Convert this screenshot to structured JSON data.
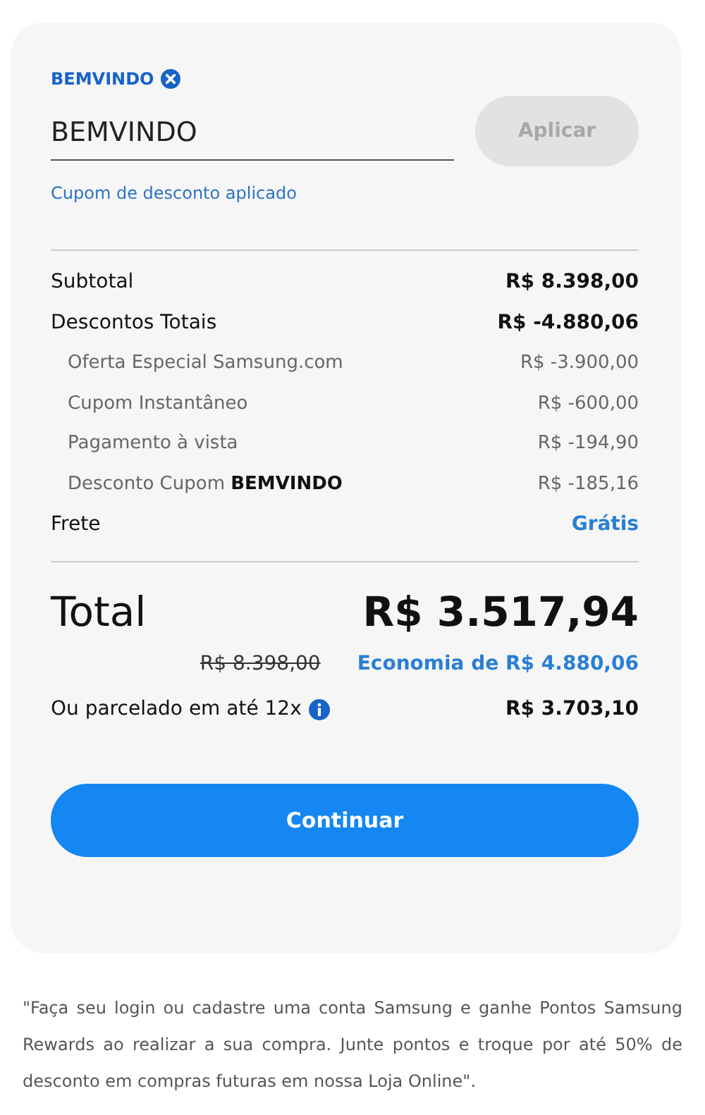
{
  "coupon": {
    "tag": "BEMVINDO",
    "value": "BEMVINDO",
    "apply_button": {
      "label": "Aplicar",
      "disabled": true
    },
    "message": "Cupom de desconto aplicado"
  },
  "summary": [
    {
      "kind": "main",
      "label": "Subtotal",
      "value": "R$ 8.398,00"
    },
    {
      "kind": "main",
      "label": "Descontos Totais",
      "value": "R$ -4.880,06"
    },
    {
      "kind": "sub",
      "label": "Oferta Especial Samsung.com",
      "value": "R$ -3.900,00"
    },
    {
      "kind": "sub",
      "label": "Cupom Instantâneo",
      "value": "R$ -600,00"
    },
    {
      "kind": "sub",
      "label": "Pagamento à vista",
      "value": "R$ -194,90"
    },
    {
      "kind": "sub",
      "label": "Desconto Cupom **BEMVINDO**",
      "value": "R$ -185,16"
    },
    {
      "kind": "free",
      "label": "Frete",
      "value": "Grátis"
    }
  ],
  "total": {
    "label": "Total",
    "value": "R$ 3.517,94",
    "original_price": "R$ 8.398,00",
    "savings": "Economia de R$ 4.880,06"
  },
  "installments": {
    "label": "Ou parcelado em até 12x",
    "value": "R$ 3.703,10"
  },
  "continue_button": "Continuar",
  "footnote": "\"Faça seu login ou cadastre uma conta Samsung e ganhe Pontos Samsung Rewards ao realizar a sua compra. Junte pontos e troque por até 50% de desconto em compras futuras em nossa Loja Online\"."
}
